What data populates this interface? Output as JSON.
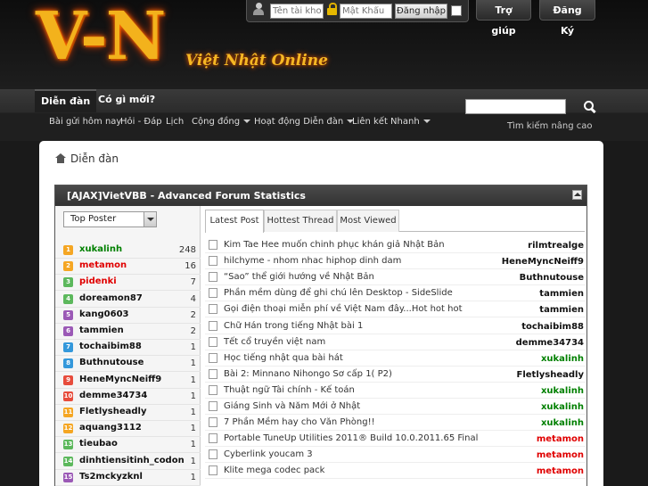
{
  "header": {
    "logo_main": "V-N",
    "logo_sub": "Việt Nhật Online",
    "login": {
      "username_placeholder": "Tên tài khoả",
      "password_placeholder": "Mật Khẩu",
      "login_label": "Đăng nhập"
    },
    "help_label": "Trợ giúp",
    "register_label": "Đăng Ký"
  },
  "navbar": {
    "tabs": [
      {
        "label": "Diễn đàn"
      },
      {
        "label": "Có gì mới?"
      }
    ],
    "subnav": [
      {
        "label": "Bài gửi hôm nay",
        "dropdown": false
      },
      {
        "label": "Hỏi - Đáp",
        "dropdown": false
      },
      {
        "label": "Lịch",
        "dropdown": false
      },
      {
        "label": "Cộng đồng",
        "dropdown": true
      },
      {
        "label": "Hoạt động Diễn đàn",
        "dropdown": true
      },
      {
        "label": "Liên kết Nhanh",
        "dropdown": true
      }
    ],
    "advanced_search": "Tìm kiếm nâng cao"
  },
  "breadcrumb": {
    "label": "Diễn đàn"
  },
  "stats": {
    "title": "[AJAX]VietVBB - Advanced Forum Statistics",
    "poster_select": "Top Poster",
    "posters": [
      {
        "rank": "1",
        "name": "xukalinh",
        "count": "248",
        "rank_color": "#f5a623",
        "name_color": "#008000"
      },
      {
        "rank": "2",
        "name": "metamon",
        "count": "16",
        "rank_color": "#f5a623",
        "name_color": "#e00000"
      },
      {
        "rank": "3",
        "name": "pidenki",
        "count": "7",
        "rank_color": "#5cb85c",
        "name_color": "#e00000"
      },
      {
        "rank": "4",
        "name": "doreamon87",
        "count": "4",
        "rank_color": "#5cb85c",
        "name_color": "#111111"
      },
      {
        "rank": "5",
        "name": "kang0603",
        "count": "2",
        "rank_color": "#9b59b6",
        "name_color": "#111111"
      },
      {
        "rank": "6",
        "name": "tammien",
        "count": "2",
        "rank_color": "#9b59b6",
        "name_color": "#111111"
      },
      {
        "rank": "7",
        "name": "tochaibim88",
        "count": "1",
        "rank_color": "#3498db",
        "name_color": "#111111"
      },
      {
        "rank": "8",
        "name": "Buthnutouse",
        "count": "1",
        "rank_color": "#3498db",
        "name_color": "#111111"
      },
      {
        "rank": "9",
        "name": "HeneMyncNeiff9",
        "count": "1",
        "rank_color": "#e74c3c",
        "name_color": "#111111"
      },
      {
        "rank": "10",
        "name": "demme34734",
        "count": "1",
        "rank_color": "#e74c3c",
        "name_color": "#111111"
      },
      {
        "rank": "11",
        "name": "Fletlysheadly",
        "count": "1",
        "rank_color": "#f5a623",
        "name_color": "#111111"
      },
      {
        "rank": "12",
        "name": "aquang3112",
        "count": "1",
        "rank_color": "#f5a623",
        "name_color": "#111111"
      },
      {
        "rank": "13",
        "name": "tieubao",
        "count": "1",
        "rank_color": "#5cb85c",
        "name_color": "#111111"
      },
      {
        "rank": "14",
        "name": "dinhtiensitinh_codon",
        "count": "1",
        "rank_color": "#5cb85c",
        "name_color": "#111111"
      },
      {
        "rank": "15",
        "name": "Ts2mckyzknl",
        "count": "1",
        "rank_color": "#9b59b6",
        "name_color": "#111111"
      }
    ],
    "tabs": [
      {
        "label": "Latest Post"
      },
      {
        "label": "Hottest Thread"
      },
      {
        "label": "Most Viewed"
      }
    ],
    "threads": [
      {
        "title": "Kim Tae Hee muốn chinh phục khán giả Nhật Bản",
        "user": "rilmtrealge",
        "user_color": "#111111"
      },
      {
        "title": "hilchyme - nhom nhac hiphop dinh dam",
        "user": "HeneMyncNeiff9",
        "user_color": "#111111"
      },
      {
        "title": "“Sao” thể giới hướng về Nhật Bản",
        "user": "Buthnutouse",
        "user_color": "#111111"
      },
      {
        "title": "Phần mềm dùng để ghi chú lên Desktop - SideSlide",
        "user": "tammien",
        "user_color": "#111111"
      },
      {
        "title": "Gọi điện thoại miễn phí về Việt Nam đây...Hot hot hot",
        "user": "tammien",
        "user_color": "#111111"
      },
      {
        "title": "Chữ Hán trong tiếng Nhật bài 1",
        "user": "tochaibim88",
        "user_color": "#111111"
      },
      {
        "title": "Tết cổ truyền việt nam",
        "user": "demme34734",
        "user_color": "#111111"
      },
      {
        "title": "Học tiếng nhật qua bài hát",
        "user": "xukalinh",
        "user_color": "#008000"
      },
      {
        "title": "Bài 2: Minnano Nihongo Sơ cấp 1( P2)",
        "user": "Fletlysheadly",
        "user_color": "#111111"
      },
      {
        "title": "Thuật ngữ Tài chính - Kế toán",
        "user": "xukalinh",
        "user_color": "#008000"
      },
      {
        "title": "Giáng Sinh và Năm Mới ở Nhật",
        "user": "xukalinh",
        "user_color": "#008000"
      },
      {
        "title": "7 Phần Mềm hay cho Văn Phòng!!",
        "user": "xukalinh",
        "user_color": "#008000"
      },
      {
        "title": "Portable TuneUp Utilities 2011® Build 10.0.2011.65 Final",
        "user": "metamon",
        "user_color": "#e00000"
      },
      {
        "title": "Cyberlink youcam 3",
        "user": "metamon",
        "user_color": "#e00000"
      },
      {
        "title": "Klite mega codec pack",
        "user": "metamon",
        "user_color": "#e00000"
      }
    ]
  }
}
